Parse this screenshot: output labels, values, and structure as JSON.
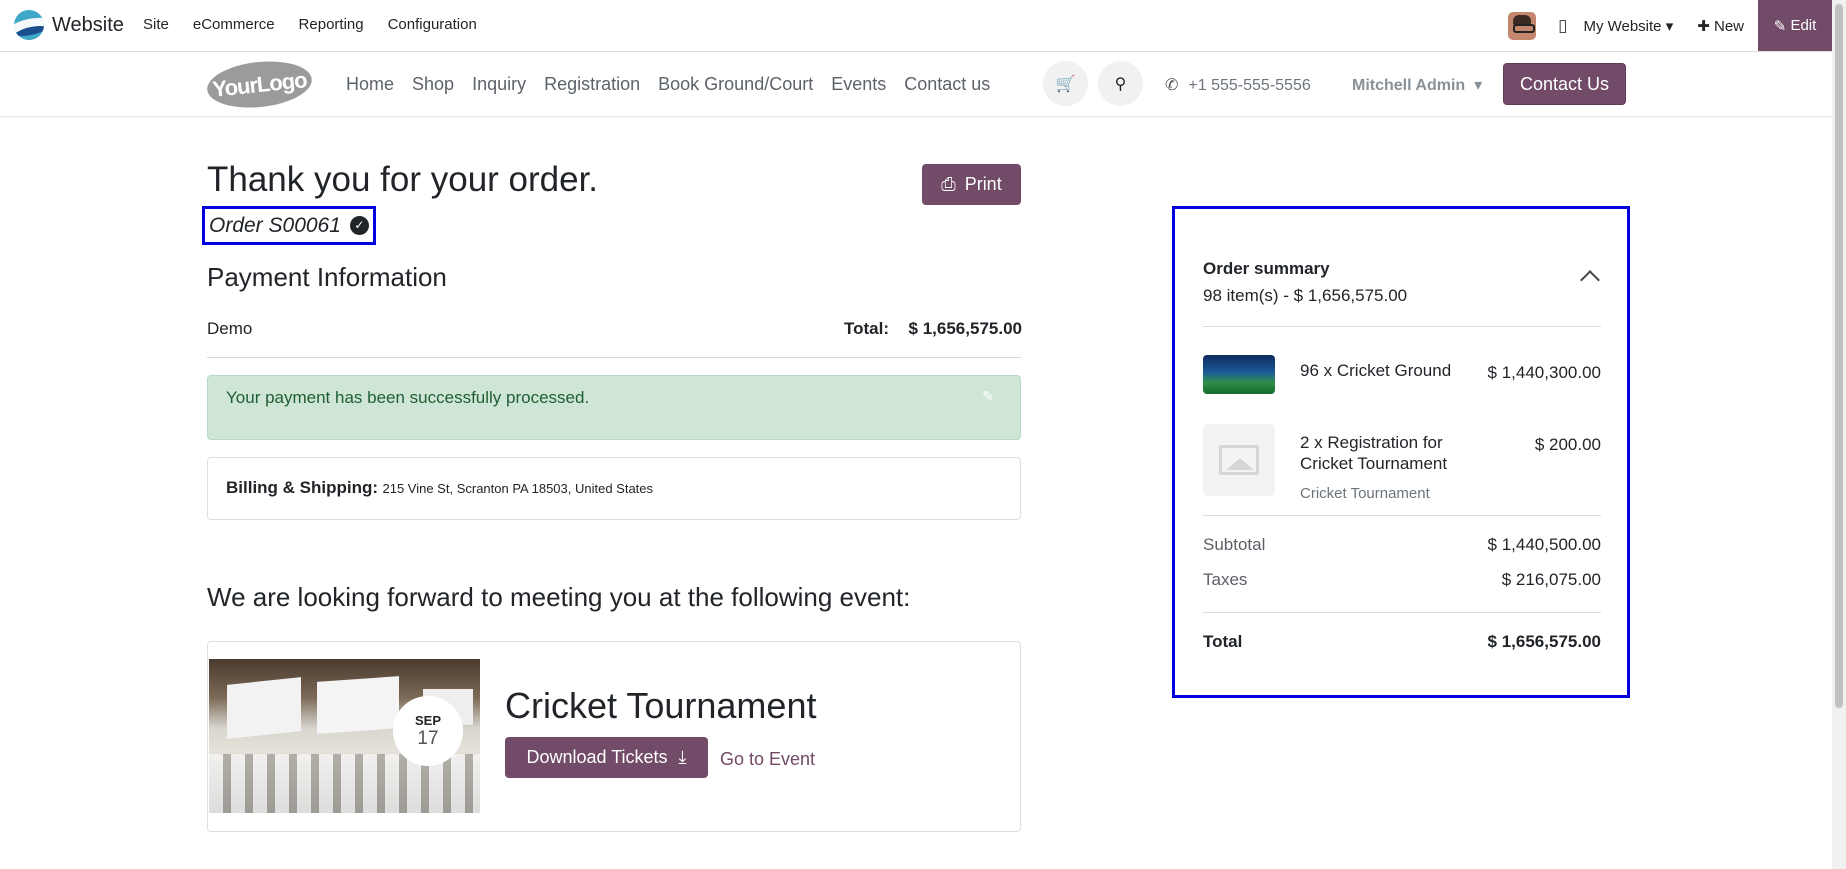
{
  "topbar": {
    "app_name": "Website",
    "menu": [
      "Site",
      "eCommerce",
      "Reporting",
      "Configuration"
    ],
    "website_select": "My Website",
    "new_label": "New",
    "edit_label": "Edit"
  },
  "header": {
    "logo_text": "YourLogo",
    "nav": [
      "Home",
      "Shop",
      "Inquiry",
      "Registration",
      "Book Ground/Court",
      "Events",
      "Contact us"
    ],
    "phone": "+1 555-555-5556",
    "user": "Mitchell Admin",
    "contact_button": "Contact Us"
  },
  "confirmation": {
    "title": "Thank you for your order.",
    "order_ref": "Order S00061",
    "print_label": "Print",
    "payment_title": "Payment Information",
    "payment_method": "Demo",
    "total_label": "Total:",
    "total_value": "$ 1,656,575.00",
    "alert": "Your payment has been successfully processed.",
    "billing_label": "Billing & Shipping:",
    "billing_address": "215 Vine St, Scranton PA 18503, United States",
    "event_heading": "We are looking forward to meeting you at the following event:"
  },
  "event": {
    "month": "SEP",
    "day": "17",
    "name": "Cricket Tournament",
    "download_label": "Download Tickets",
    "goto_label": "Go to Event"
  },
  "summary": {
    "title": "Order summary",
    "items_line": "98 item(s) -  $ 1,656,575.00",
    "items": [
      {
        "name": "96 x Cricket Ground",
        "price": "$ 1,440,300.00",
        "sub": ""
      },
      {
        "name": "2 x Registration for Cricket Tournament",
        "price": "$ 200.00",
        "sub": "Cricket Tournament"
      }
    ],
    "subtotal_label": "Subtotal",
    "subtotal_value": "$ 1,440,500.00",
    "taxes_label": "Taxes",
    "taxes_value": "$ 216,075.00",
    "total_label": "Total",
    "total_value": "$ 1,656,575.00"
  }
}
